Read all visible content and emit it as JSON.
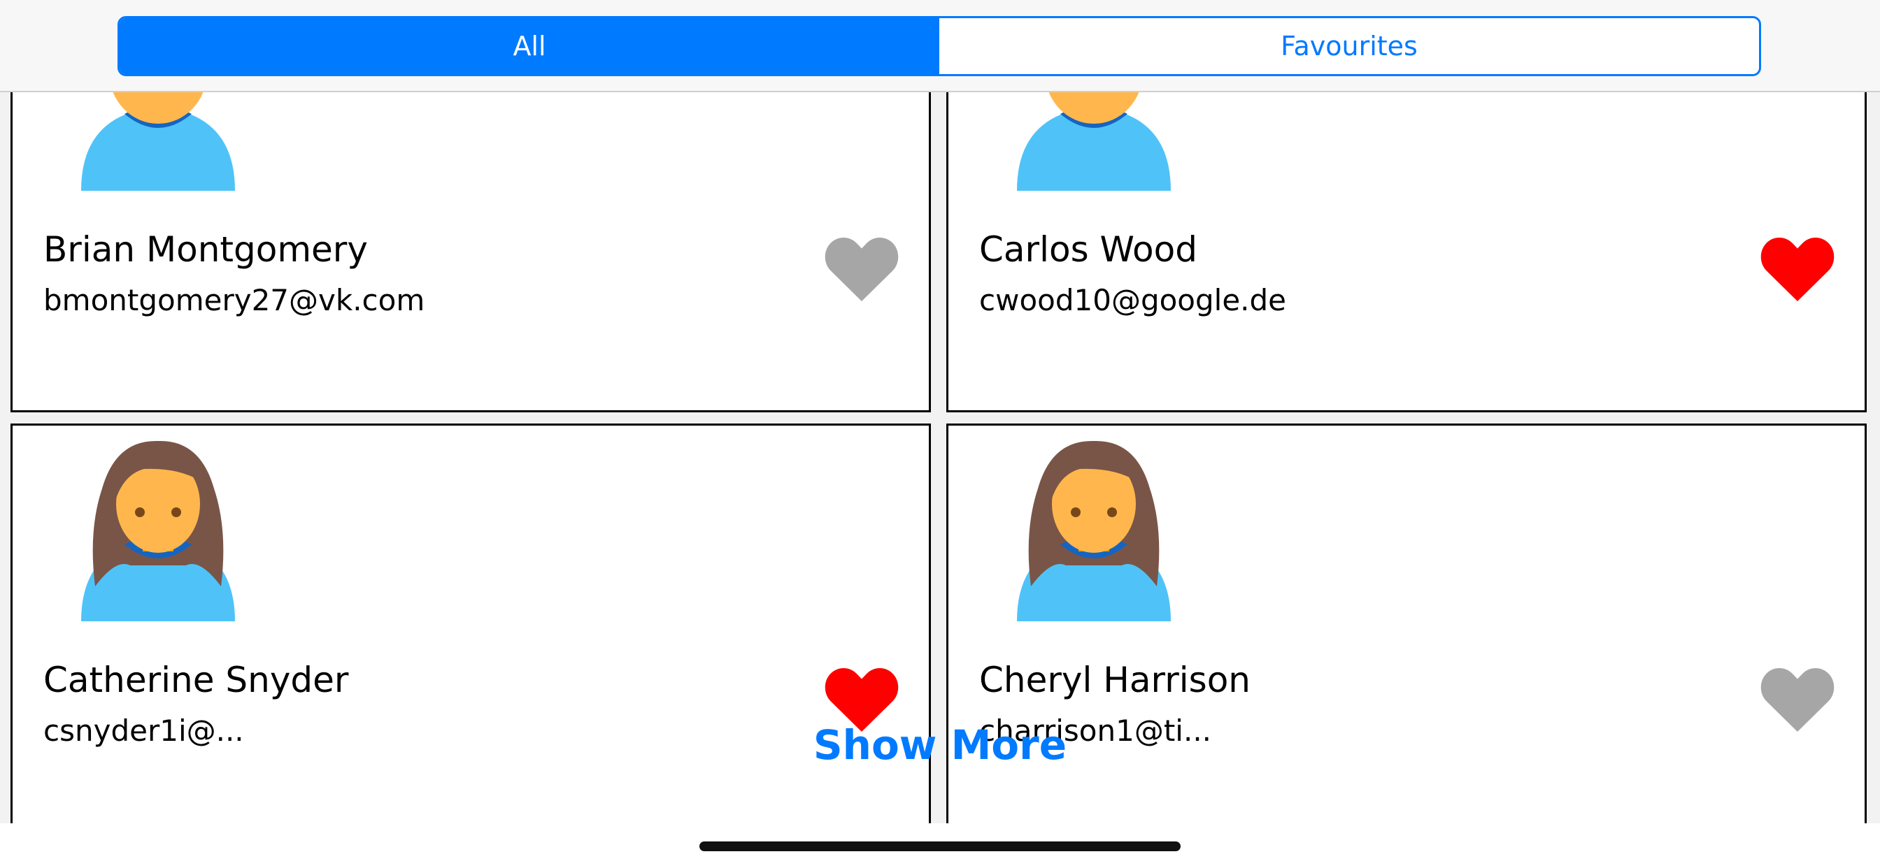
{
  "tabs": {
    "all_label": "All",
    "favourites_label": "Favourites",
    "selected": "All"
  },
  "contacts": [
    {
      "name": "Brian Montgomery",
      "email": "bmontgomery27@vk.com",
      "avatar": "male-avatar-icon",
      "favourite": false
    },
    {
      "name": "Carlos Wood",
      "email": "cwood10@google.de",
      "avatar": "male-avatar-icon",
      "favourite": true
    },
    {
      "name": "Catherine Snyder",
      "email": "csnyder1i@...",
      "avatar": "female-avatar-icon",
      "favourite": true
    },
    {
      "name": "Cheryl Harrison",
      "email": "charrison1@ti...",
      "avatar": "female-avatar-icon",
      "favourite": false
    }
  ],
  "show_more_label": "Show More",
  "colors": {
    "accent": "#007aff",
    "favourite_on": "#ff0000",
    "favourite_off": "#a6a6a6"
  }
}
